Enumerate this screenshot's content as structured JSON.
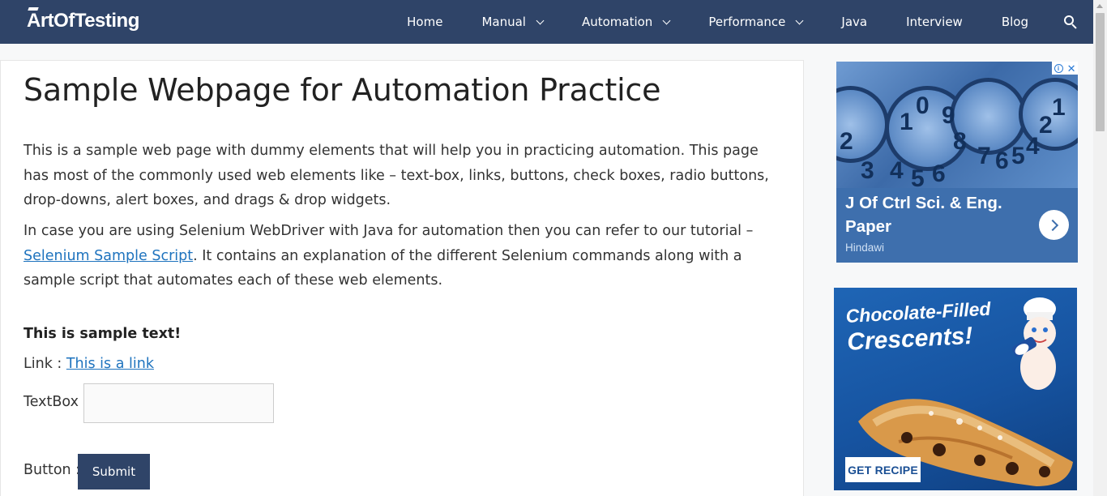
{
  "header": {
    "logo": "ArtOfTesting",
    "nav": [
      {
        "label": "Home",
        "has_dropdown": false
      },
      {
        "label": "Manual",
        "has_dropdown": true
      },
      {
        "label": "Automation",
        "has_dropdown": true
      },
      {
        "label": "Performance",
        "has_dropdown": true
      },
      {
        "label": "Java",
        "has_dropdown": false
      },
      {
        "label": "Interview",
        "has_dropdown": false
      },
      {
        "label": "Blog",
        "has_dropdown": false
      }
    ],
    "search_icon": "search-icon",
    "bar_color": "#2f4468"
  },
  "main": {
    "title": "Sample Webpage for Automation Practice",
    "para1": "This is a sample web page with dummy elements that will help you in practicing automation. This page has most of the commonly used web elements like – text-box, links, buttons, check boxes, radio buttons, drop-downs, alert boxes, and drags & drop widgets.",
    "para2_before": "In case you are using Selenium WebDriver with Java for automation then you can refer to our tutorial – ",
    "para2_link": "Selenium Sample Script",
    "para2_after": ". It contains an explanation of the different Selenium commands along with a sample script that automates each of these web elements.",
    "sample_text": "This is sample text!",
    "link_label": "Link : ",
    "link_text": "This is a link",
    "textbox_label": "TextBox : ",
    "textbox_value": "",
    "button_label": "Button : ",
    "submit_label": "Submit",
    "link_color": "#1e73be",
    "button_color": "#2f4468"
  },
  "ads": {
    "ad1": {
      "title": "J Of Ctrl Sci. & Eng. Paper",
      "source": "Hindawi",
      "background": "#3e6fad"
    },
    "ad2": {
      "headline_line1": "Chocolate-Filled",
      "headline_line2": "Crescents!",
      "cta": "GET RECIPE",
      "background": "#1653a0"
    }
  }
}
